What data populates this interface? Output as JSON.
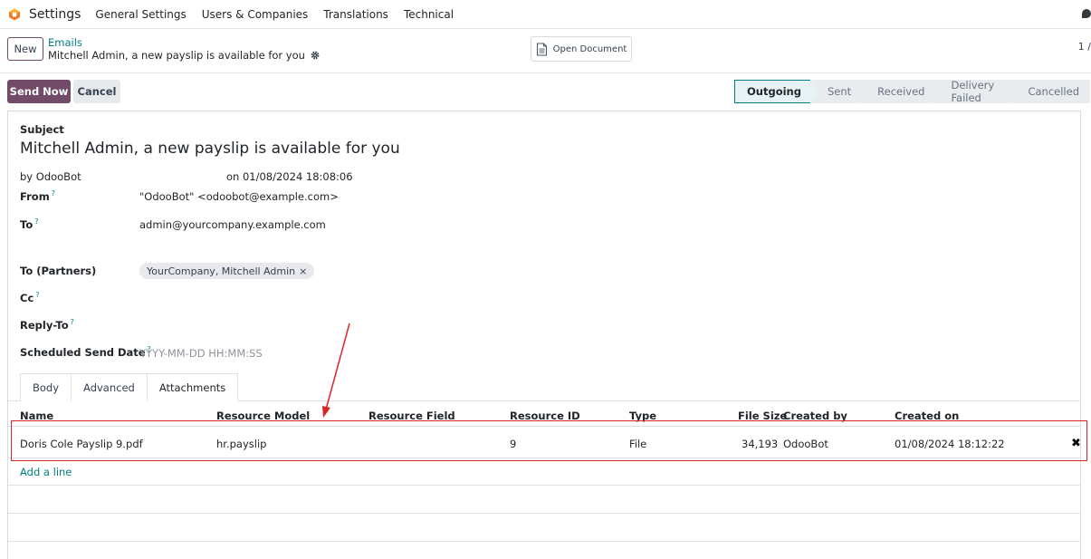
{
  "navbar": {
    "app_name": "Settings",
    "menu": [
      "General Settings",
      "Users & Companies",
      "Translations",
      "Technical"
    ]
  },
  "control": {
    "new_label": "New",
    "breadcrumb": "Emails",
    "record_title": "Mitchell Admin, a new payslip is available for you",
    "open_document_label": "Open Document",
    "pager": "1 /"
  },
  "statusbar": {
    "send_now_label": "Send Now",
    "cancel_label": "Cancel",
    "stages": [
      "Outgoing",
      "Sent",
      "Received",
      "Delivery Failed",
      "Cancelled"
    ],
    "active_stage": "Outgoing"
  },
  "form": {
    "subject_label": "Subject",
    "subject_value": "Mitchell Admin, a new payslip is available for you",
    "author": "by OdooBot",
    "date": "on 01/08/2024 18:08:06",
    "from_label": "From",
    "from_value": "\"OdooBot\" <odoobot@example.com>",
    "to_label": "To",
    "to_value": "admin@yourcompany.example.com",
    "to_partners_label": "To (Partners)",
    "to_partners_tag": "YourCompany, Mitchell Admin",
    "cc_label": "Cc",
    "reply_to_label": "Reply-To",
    "scheduled_label": "Scheduled Send Date",
    "scheduled_placeholder": "YYYY-MM-DD HH:MM:SS",
    "help_mark": "?"
  },
  "tabs": [
    "Body",
    "Advanced",
    "Attachments"
  ],
  "active_tab": "Attachments",
  "attachments": {
    "columns": [
      "Name",
      "Resource Model",
      "Resource Field",
      "Resource ID",
      "Type",
      "File Size",
      "Created by",
      "Created on"
    ],
    "rows": [
      {
        "name": "Doris Cole Payslip 9.pdf",
        "resource_model": "hr.payslip",
        "resource_field": "",
        "resource_id": "9",
        "type": "File",
        "file_size": "34,193",
        "created_by": "OdooBot",
        "created_on": "01/08/2024 18:12:22"
      }
    ],
    "add_line_label": "Add a line"
  },
  "colors": {
    "brand": "#714b67",
    "link": "#017e84",
    "highlight": "#d9252a"
  }
}
